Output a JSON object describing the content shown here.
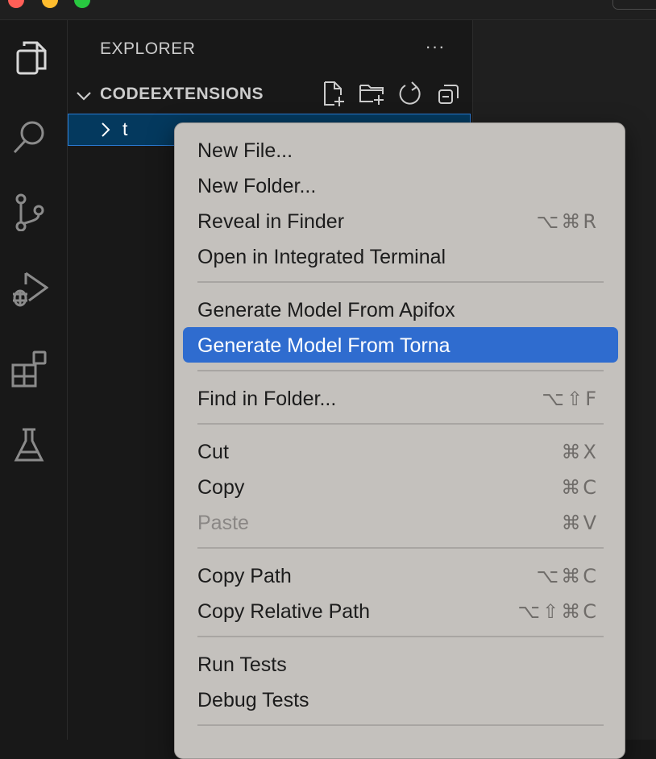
{
  "explorer": {
    "title": "EXPLORER",
    "more_actions": "···",
    "workspace_name": "CODEEXTENSIONS",
    "tree": [
      {
        "label": "t",
        "expanded": false,
        "selected": true
      }
    ]
  },
  "activity_bar": [
    {
      "icon": "files-icon",
      "active": true
    },
    {
      "icon": "search-icon",
      "active": false
    },
    {
      "icon": "source-control-icon",
      "active": false
    },
    {
      "icon": "run-debug-icon",
      "active": false
    },
    {
      "icon": "extensions-icon",
      "active": false
    },
    {
      "icon": "testing-flask-icon",
      "active": false
    }
  ],
  "workspace_actions": [
    "new-file-icon",
    "new-folder-icon",
    "refresh-icon",
    "collapse-all-icon"
  ],
  "context_menu": {
    "items": [
      {
        "label": "New File...",
        "shortcut": ""
      },
      {
        "label": "New Folder...",
        "shortcut": ""
      },
      {
        "label": "Reveal in Finder",
        "shortcut": "⌥⌘R"
      },
      {
        "label": "Open in Integrated Terminal",
        "shortcut": ""
      },
      {
        "label": "Generate Model From Apifox",
        "shortcut": ""
      },
      {
        "label": "Generate Model From Torna",
        "shortcut": "",
        "highlighted": true
      },
      {
        "label": "Find in Folder...",
        "shortcut": "⌥⇧F"
      },
      {
        "label": "Cut",
        "shortcut": "⌘X"
      },
      {
        "label": "Copy",
        "shortcut": "⌘C"
      },
      {
        "label": "Paste",
        "shortcut": "⌘V",
        "disabled": true
      },
      {
        "label": "Copy Path",
        "shortcut": "⌥⌘C"
      },
      {
        "label": "Copy Relative Path",
        "shortcut": "⌥⇧⌘C"
      },
      {
        "label": "Run Tests",
        "shortcut": ""
      },
      {
        "label": "Debug Tests",
        "shortcut": ""
      }
    ]
  },
  "colors": {
    "highlight": "#2f6ccf",
    "menu_bg": "#c4c1bd",
    "selection_bg": "#04395e",
    "selection_border": "#2b7ad1"
  }
}
